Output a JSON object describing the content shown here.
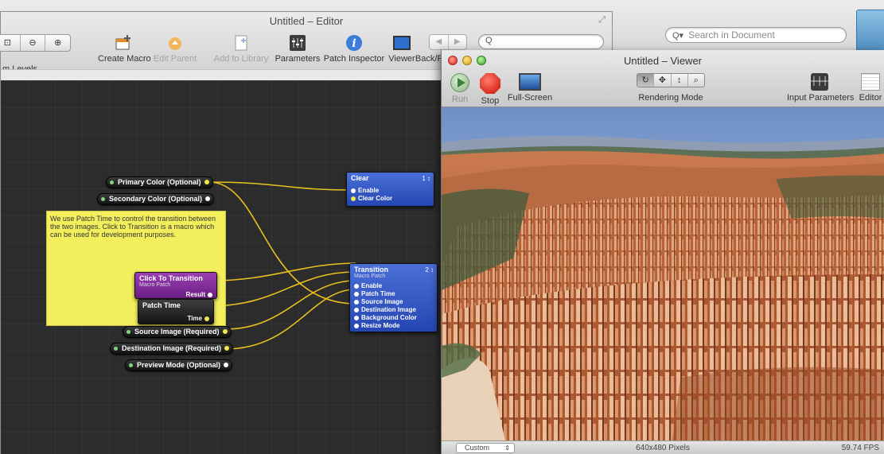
{
  "background_window": {
    "search_placeholder": "Search in Document"
  },
  "editor": {
    "title": "Untitled – Editor",
    "toolbar": {
      "zoom_label": "m Levels",
      "create_macro": "Create Macro",
      "edit_parent": "Edit Parent",
      "add_to_library": "Add to Library",
      "parameters": "Parameters",
      "patch_inspector": "Patch Inspector",
      "viewer": "Viewer",
      "back_forward": "Back/F"
    },
    "published_inputs": [
      "Primary Color (Optional)",
      "Secondary Color (Optional)",
      "Source Image (Required)",
      "Destination Image (Required)",
      "Preview Mode (Optional)"
    ],
    "note": "We use Patch Time to control the transition between the two images.  Click to Transition is a macro which can be used for development purposes.",
    "patches": {
      "clear": {
        "title": "Clear",
        "count": "1 ↕",
        "inputs": [
          "Enable",
          "Clear Color"
        ]
      },
      "transition": {
        "title": "Transition",
        "subtitle": "Macro Patch",
        "count": "2 ↕",
        "inputs": [
          "Enable",
          "Patch Time",
          "Source Image",
          "Destination Image",
          "Background Color",
          "Resize Mode"
        ]
      },
      "click_to_transition": {
        "title": "Click To Transition",
        "subtitle": "Macro Patch",
        "output": "Result"
      },
      "patch_time": {
        "title": "Patch Time",
        "output": "Time"
      }
    },
    "colors": {
      "wire": "#e8c21e",
      "note": "#f3ee5c",
      "consumer_patch": "#2f52c4",
      "macro_patch": "#7e2a98"
    }
  },
  "viewer": {
    "title": "Untitled – Viewer",
    "toolbar": {
      "run": "Run",
      "stop": "Stop",
      "full_screen": "Full-Screen",
      "rendering_mode": "Rendering Mode",
      "input_parameters": "Input Parameters",
      "editor": "Editor"
    },
    "status": {
      "size_select": "Custom",
      "resolution": "640x480 Pixels",
      "fps": "59.74 FPS"
    }
  }
}
